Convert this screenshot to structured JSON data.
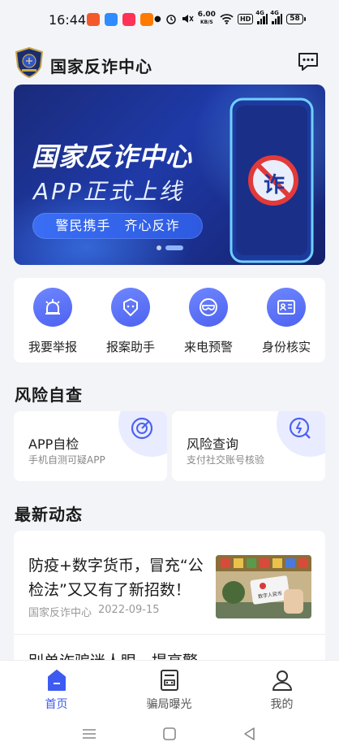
{
  "status_bar": {
    "time": "16:44",
    "speed_value": "6.00",
    "speed_unit": "KB/S",
    "hd": "HD",
    "net1": "4G",
    "net2": "4G",
    "battery": "58"
  },
  "header": {
    "title": "国家反诈中心"
  },
  "banner": {
    "title": "国家反诈中心",
    "subtitle": "APP正式上线",
    "pill": "警民携手　齐心反诈",
    "phone_glyph": "诈"
  },
  "quick_actions": [
    {
      "label": "我要举报",
      "icon": "alarm-light-icon"
    },
    {
      "label": "报案助手",
      "icon": "shield-assistant-icon"
    },
    {
      "label": "来电预警",
      "icon": "mask-warning-icon"
    },
    {
      "label": "身份核实",
      "icon": "id-card-icon"
    }
  ],
  "risk_section": {
    "title": "风险自查",
    "cards": [
      {
        "name": "APP自检",
        "desc": "手机自测可疑APP",
        "icon": "scan-target-icon"
      },
      {
        "name": "风险查询",
        "desc": "支付社交账号核验",
        "icon": "lightning-search-icon"
      }
    ]
  },
  "news_section": {
    "title": "最新动态",
    "items": [
      {
        "title": "防疫+数字货币，冒充“公检法”又又有了新招数！",
        "source": "国家反诈中心",
        "date": "2022-09-15"
      },
      {
        "title": "别单诈骗迷人眼，提高警"
      }
    ],
    "thumb_caption": "数字人民币"
  },
  "bottom_nav": [
    {
      "label": "首页",
      "icon": "home-icon",
      "active": true
    },
    {
      "label": "骗局曝光",
      "icon": "document-exposure-icon",
      "active": false
    },
    {
      "label": "我的",
      "icon": "profile-icon",
      "active": false
    }
  ],
  "colors": {
    "accent": "#3d5af1",
    "icon_gradient_start": "#6f87ff",
    "icon_gradient_end": "#4d62f0",
    "banner_dark": "#14206a",
    "background": "#f3f4f8"
  }
}
